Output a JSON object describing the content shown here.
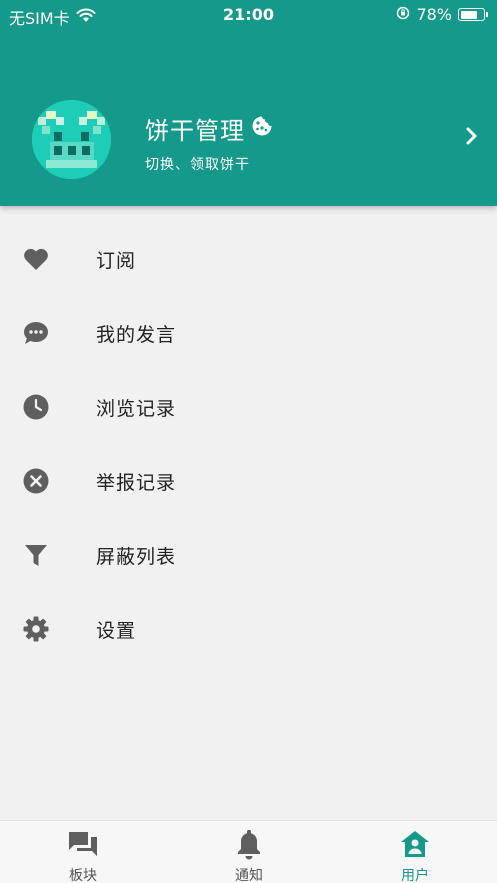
{
  "status_bar": {
    "carrier": "无SIM卡",
    "time": "21:00",
    "battery": "78%",
    "battery_level": 0.78
  },
  "profile": {
    "name": "饼干管理",
    "subtitle": "切换、领取饼干"
  },
  "menu": {
    "items": [
      {
        "label": "订阅",
        "icon": "heart-icon"
      },
      {
        "label": "我的发言",
        "icon": "chat-bubble-icon"
      },
      {
        "label": "浏览记录",
        "icon": "clock-icon"
      },
      {
        "label": "举报记录",
        "icon": "close-circle-icon"
      },
      {
        "label": "屏蔽列表",
        "icon": "filter-icon"
      },
      {
        "label": "设置",
        "icon": "gear-icon"
      }
    ]
  },
  "tabbar": {
    "tabs": [
      {
        "label": "板块",
        "icon": "forum-icon",
        "active": false
      },
      {
        "label": "通知",
        "icon": "bell-icon",
        "active": false
      },
      {
        "label": "用户",
        "icon": "home-user-icon",
        "active": true
      }
    ]
  },
  "colors": {
    "primary": "#14998a",
    "icon_gray": "#5f5f5f",
    "background": "#f1f1f1"
  }
}
